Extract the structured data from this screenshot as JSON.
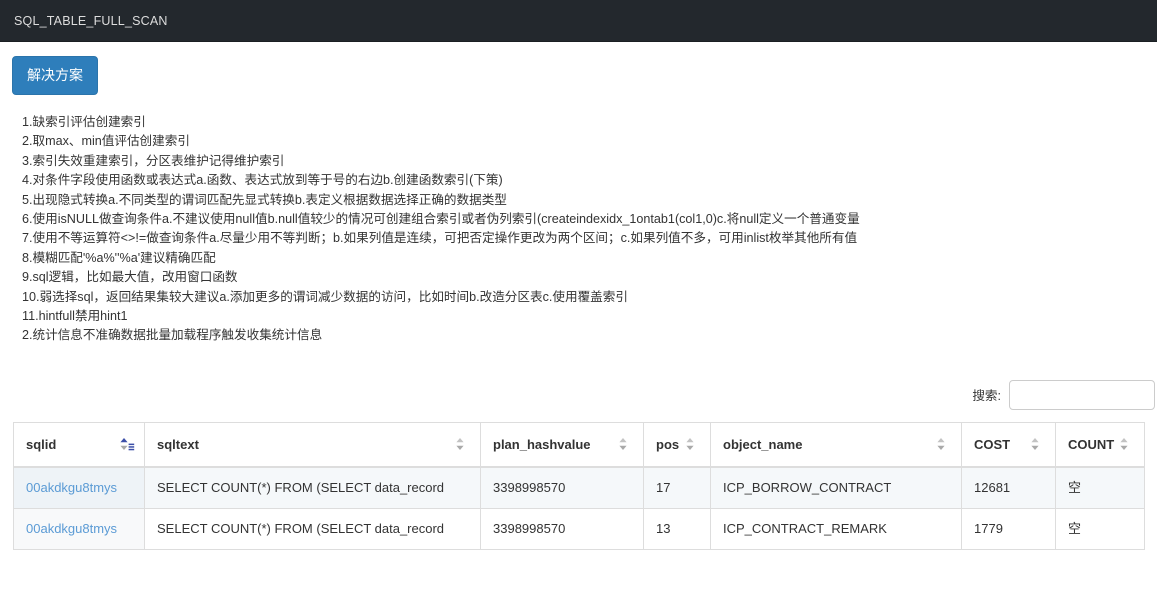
{
  "navbar": {
    "brand": "SQL_TABLE_FULL_SCAN"
  },
  "toolbar": {
    "solution_label": "解决方案"
  },
  "advice": {
    "lines": [
      "1.缺索引评估创建索引",
      "2.取max、min值评估创建索引",
      "3.索引失效重建索引，分区表维护记得维护索引",
      "4.对条件字段使用函数或表达式a.函数、表达式放到等于号的右边b.创建函数索引(下策)",
      "5.出现隐式转换a.不同类型的谓词匹配先显式转换b.表定义根据数据选择正确的数据类型",
      "6.使用isNULL做查询条件a.不建议使用null值b.null值较少的情况可创建组合索引或者伪列索引(createindexidx_1ontab1(col1,0)c.将null定义一个普通变量",
      "7.使用不等运算符<>!=做查询条件a.尽量少用不等判断；b.如果列值是连续，可把否定操作更改为两个区间；c.如果列值不多，可用inlist枚举其他所有值",
      "8.模糊匹配'%a%''%a'建议精确匹配",
      "9.sql逻辑，比如最大值，改用窗口函数",
      "10.弱选择sql，返回结果集较大建议a.添加更多的谓词减少数据的访问，比如时间b.改造分区表c.使用覆盖索引",
      "11.hintfull禁用hint1",
      "2.统计信息不准确数据批量加载程序触发收集统计信息"
    ]
  },
  "search": {
    "label": "搜索:",
    "value": "",
    "placeholder": ""
  },
  "table": {
    "columns": [
      {
        "key": "sqlid",
        "label": "sqlid",
        "sort": "asc"
      },
      {
        "key": "sqltext",
        "label": "sqltext",
        "sort": "none"
      },
      {
        "key": "plan_hashvalue",
        "label": "plan_hashvalue",
        "sort": "none"
      },
      {
        "key": "pos",
        "label": "pos",
        "sort": "none"
      },
      {
        "key": "object_name",
        "label": "object_name",
        "sort": "none"
      },
      {
        "key": "cost",
        "label": "COST",
        "sort": "none"
      },
      {
        "key": "count",
        "label": "COUNT",
        "sort": "none"
      }
    ],
    "rows": [
      {
        "sqlid": "00akdkgu8tmys",
        "sqltext": "SELECT COUNT(*) FROM (SELECT data_record",
        "plan_hashvalue": "3398998570",
        "pos": "17",
        "object_name": "ICP_BORROW_CONTRACT",
        "cost": "12681",
        "count": "空"
      },
      {
        "sqlid": "00akdkgu8tmys",
        "sqltext": "SELECT COUNT(*) FROM (SELECT data_record",
        "plan_hashvalue": "3398998570",
        "pos": "13",
        "object_name": "ICP_CONTRACT_REMARK",
        "cost": "1779",
        "count": "空"
      }
    ]
  },
  "colors": {
    "navbar_bg": "#23282d",
    "primary_button": "#2e7ebb",
    "link": "#5b9bd5",
    "row_stripe": "#f5f8fa",
    "border": "#dddddd"
  }
}
